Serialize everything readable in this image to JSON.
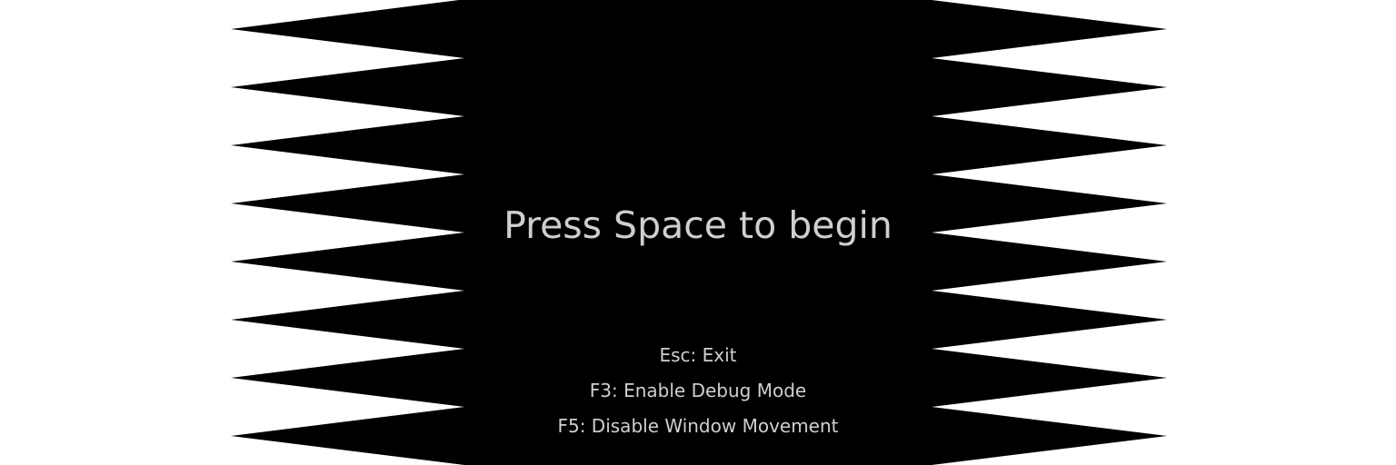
{
  "screen": {
    "title": "Press Space to begin",
    "controls": [
      {
        "label": "Esc: Exit"
      },
      {
        "label": "F3: Enable Debug Mode"
      },
      {
        "label": "F5: Disable Window Movement"
      }
    ]
  },
  "colors": {
    "background": "#ffffff",
    "shape": "#000000",
    "text": "#cfcfcf"
  }
}
